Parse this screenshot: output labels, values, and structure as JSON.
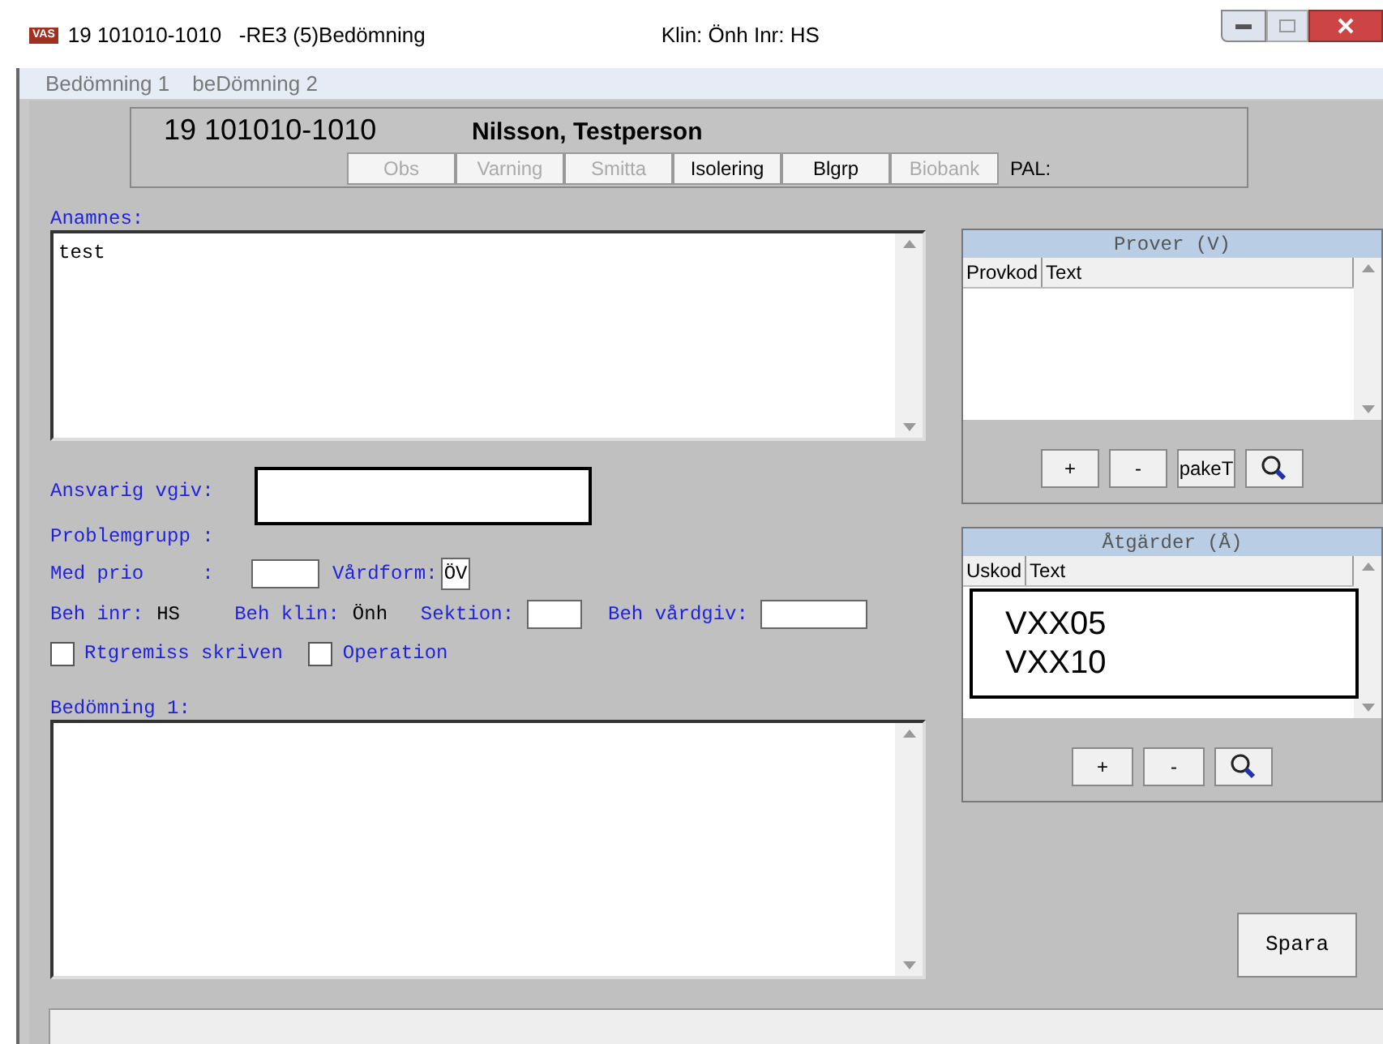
{
  "window": {
    "badge": "VAS",
    "title": "19 101010-1010   -RE3 (5)Bedömning",
    "info": "Klin: Önh  Inr: HS"
  },
  "menu": [
    {
      "label": "Bedömning 1"
    },
    {
      "label": "beDömning 2"
    }
  ],
  "patient": {
    "id": "19 101010-1010",
    "name": "Nilsson, Testperson",
    "pal": "PAL:",
    "flags": [
      {
        "label": "Obs",
        "disabled": true
      },
      {
        "label": "Varning",
        "disabled": true
      },
      {
        "label": "Smitta",
        "disabled": true
      },
      {
        "label": "Isolering",
        "disabled": false
      },
      {
        "label": "Blgrp",
        "disabled": false
      },
      {
        "label": "Biobank",
        "disabled": true
      }
    ]
  },
  "anamnes": {
    "label": "Anamnes:",
    "value": "test"
  },
  "fields": {
    "ansvarig": "Ansvarig vgiv:",
    "problemgrupp": "Problemgrupp :",
    "med_prio": "Med prio     :",
    "vardform": "Vårdform:",
    "vardform_value": "ÖV",
    "beh_inr": "Beh inr:",
    "beh_inr_value": "HS",
    "beh_klin": "Beh klin:",
    "beh_klin_value": "Önh",
    "sektion": "Sektion:",
    "beh_vardgiv": "Beh vårdgiv:"
  },
  "checkboxes": [
    {
      "label": "Rtgremiss skriven",
      "checked": false
    },
    {
      "label": "Operation",
      "checked": false
    }
  ],
  "bedomning": {
    "label": "Bedömning 1:"
  },
  "prover": {
    "title": "Prover (V)",
    "columns": [
      "Provkod",
      "Text"
    ],
    "buttons": [
      {
        "kind": "text",
        "label": "+"
      },
      {
        "kind": "text",
        "label": "-"
      },
      {
        "kind": "text",
        "label": "pakeT"
      },
      {
        "kind": "search"
      }
    ]
  },
  "atgarder": {
    "title": "Åtgärder (Å)",
    "columns": [
      "Uskod",
      "Text"
    ],
    "popup": [
      "VXX05",
      "VXX10"
    ],
    "buttons": [
      {
        "kind": "text",
        "label": "+"
      },
      {
        "kind": "text",
        "label": "-"
      },
      {
        "kind": "search"
      }
    ]
  },
  "save": "Spara"
}
